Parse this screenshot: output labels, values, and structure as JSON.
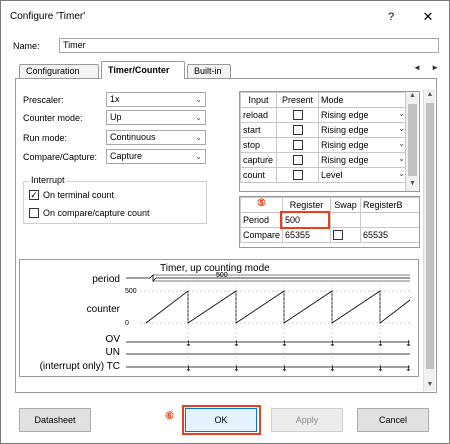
{
  "window": {
    "title": "Configure 'Timer'",
    "help": "?",
    "close": "✕"
  },
  "name": {
    "label": "Name:",
    "value": "Timer"
  },
  "tabs": [
    {
      "label": "Configuration"
    },
    {
      "label": "Timer/Counter"
    },
    {
      "label": "Built-in"
    }
  ],
  "tab_arrows": "◄ ►",
  "fields": {
    "prescaler": {
      "label": "Prescaler:",
      "value": "1x"
    },
    "counter_mode": {
      "label": "Counter mode:",
      "value": "Up"
    },
    "run_mode": {
      "label": "Run mode:",
      "value": "Continuous"
    },
    "compare_capture": {
      "label": "Compare/Capture:",
      "value": "Capture"
    }
  },
  "interrupt": {
    "title": "Interrupt",
    "on_terminal_count": {
      "label": "On terminal count",
      "checked": true
    },
    "on_compare": {
      "label": "On compare/capture count",
      "checked": false
    }
  },
  "signals": {
    "headers": [
      "Input",
      "Present",
      "Mode"
    ],
    "rows": [
      {
        "input": "reload",
        "present": false,
        "mode": "Rising edge"
      },
      {
        "input": "start",
        "present": false,
        "mode": "Rising edge"
      },
      {
        "input": "stop",
        "present": false,
        "mode": "Rising edge"
      },
      {
        "input": "capture",
        "present": false,
        "mode": "Rising edge"
      },
      {
        "input": "count",
        "present": false,
        "mode": "Level"
      }
    ]
  },
  "registers": {
    "headers": [
      "",
      "Register",
      "Swap",
      "RegisterB"
    ],
    "rows": [
      {
        "name": "Period",
        "register": "500",
        "swap": null,
        "register_b": ""
      },
      {
        "name": "Compare",
        "register": "65355",
        "swap": false,
        "register_b": "65535"
      }
    ]
  },
  "callouts": {
    "five": "⑤",
    "six": "⑥"
  },
  "diagram": {
    "title": "Timer, up counting mode",
    "period_label": "period",
    "period_value": "500",
    "counter_label": "counter",
    "counter_max": "500",
    "counter_min": "0",
    "ov_label": "OV",
    "un_label": "UN",
    "tc_label": "(interrupt only) TC"
  },
  "buttons": {
    "datasheet": "Datasheet",
    "ok": "OK",
    "apply": "Apply",
    "cancel": "Cancel"
  },
  "colors": {
    "callout": "#e8401c"
  }
}
